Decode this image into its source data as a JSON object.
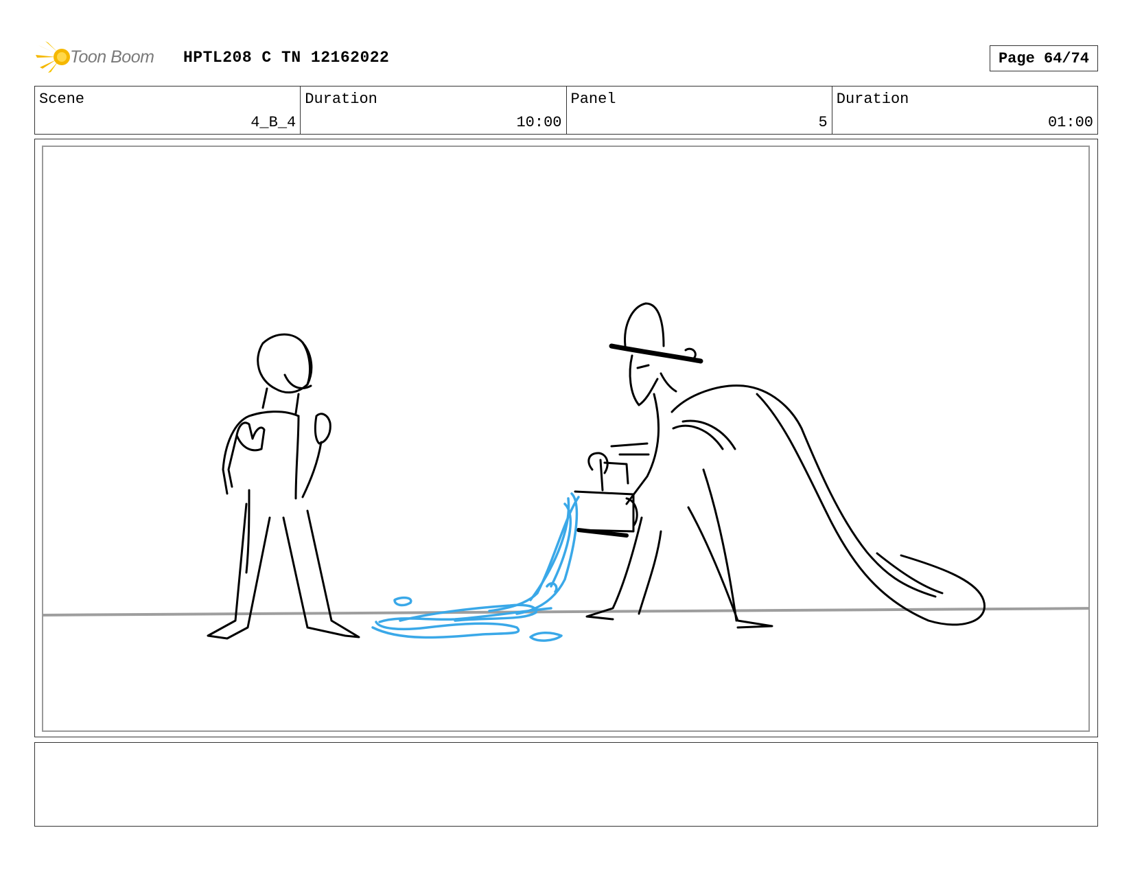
{
  "header": {
    "logo_text": "Toon Boom",
    "project_title": "HPTL208 C TN 12162022",
    "page_label": "Page 64/74"
  },
  "info": {
    "scene_label": "Scene",
    "scene_value": "4_B_4",
    "scene_duration_label": "Duration",
    "scene_duration_value": "10:00",
    "panel_label": "Panel",
    "panel_value": "5",
    "panel_duration_label": "Duration",
    "panel_duration_value": "01:00"
  },
  "colors": {
    "sketch": "#000000",
    "water": "#3aa8e8",
    "ground": "#9e9e9e",
    "logo": "#f5b800"
  },
  "caption": {
    "text": ""
  }
}
